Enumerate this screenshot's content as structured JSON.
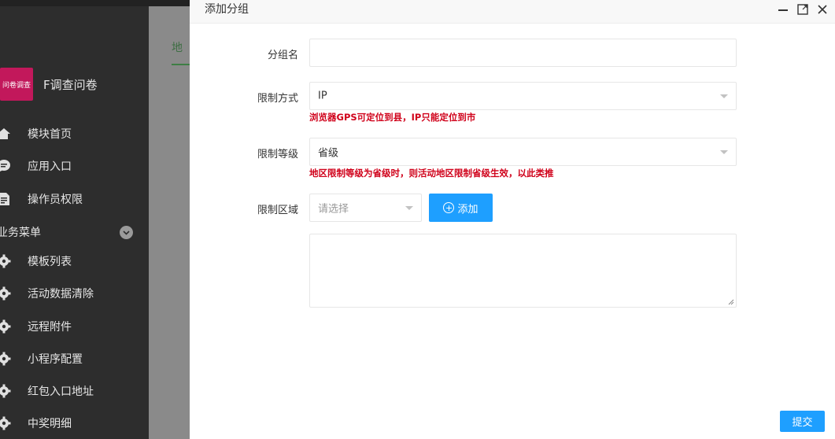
{
  "sidebar": {
    "brand_logo_text": "问卷调查",
    "brand_name": "F调查问卷",
    "items": [
      {
        "label": "模块首页",
        "icon": "home-icon"
      },
      {
        "label": "应用入口",
        "icon": "chat-bubble-icon"
      },
      {
        "label": "操作员权限",
        "icon": "document-icon"
      }
    ],
    "group": {
      "label": "业务菜单",
      "icon": "chevron-down-icon"
    },
    "group_items": [
      {
        "label": "模板列表",
        "icon": "gear-icon"
      },
      {
        "label": "活动数据清除",
        "icon": "gear-icon"
      },
      {
        "label": "远程附件",
        "icon": "gear-icon"
      },
      {
        "label": "小程序配置",
        "icon": "gear-icon"
      },
      {
        "label": "红包入口地址",
        "icon": "gear-icon"
      },
      {
        "label": "中奖明细",
        "icon": "gear-icon"
      }
    ]
  },
  "backdrop": {
    "tab_label": "地"
  },
  "dialog": {
    "title": "添加分组",
    "fields": {
      "group_name": {
        "label": "分组名",
        "value": ""
      },
      "limit_method": {
        "label": "限制方式",
        "value": "IP",
        "hint": "浏览器GPS可定位到县，IP只能定位到市"
      },
      "limit_level": {
        "label": "限制等级",
        "value": "省级",
        "hint": "地区限制等级为省级时，则活动地区限制省级生效，以此类推"
      },
      "limit_region": {
        "label": "限制区域",
        "placeholder": "请选择",
        "add_label": "添加"
      }
    },
    "submit_label": "提交"
  }
}
